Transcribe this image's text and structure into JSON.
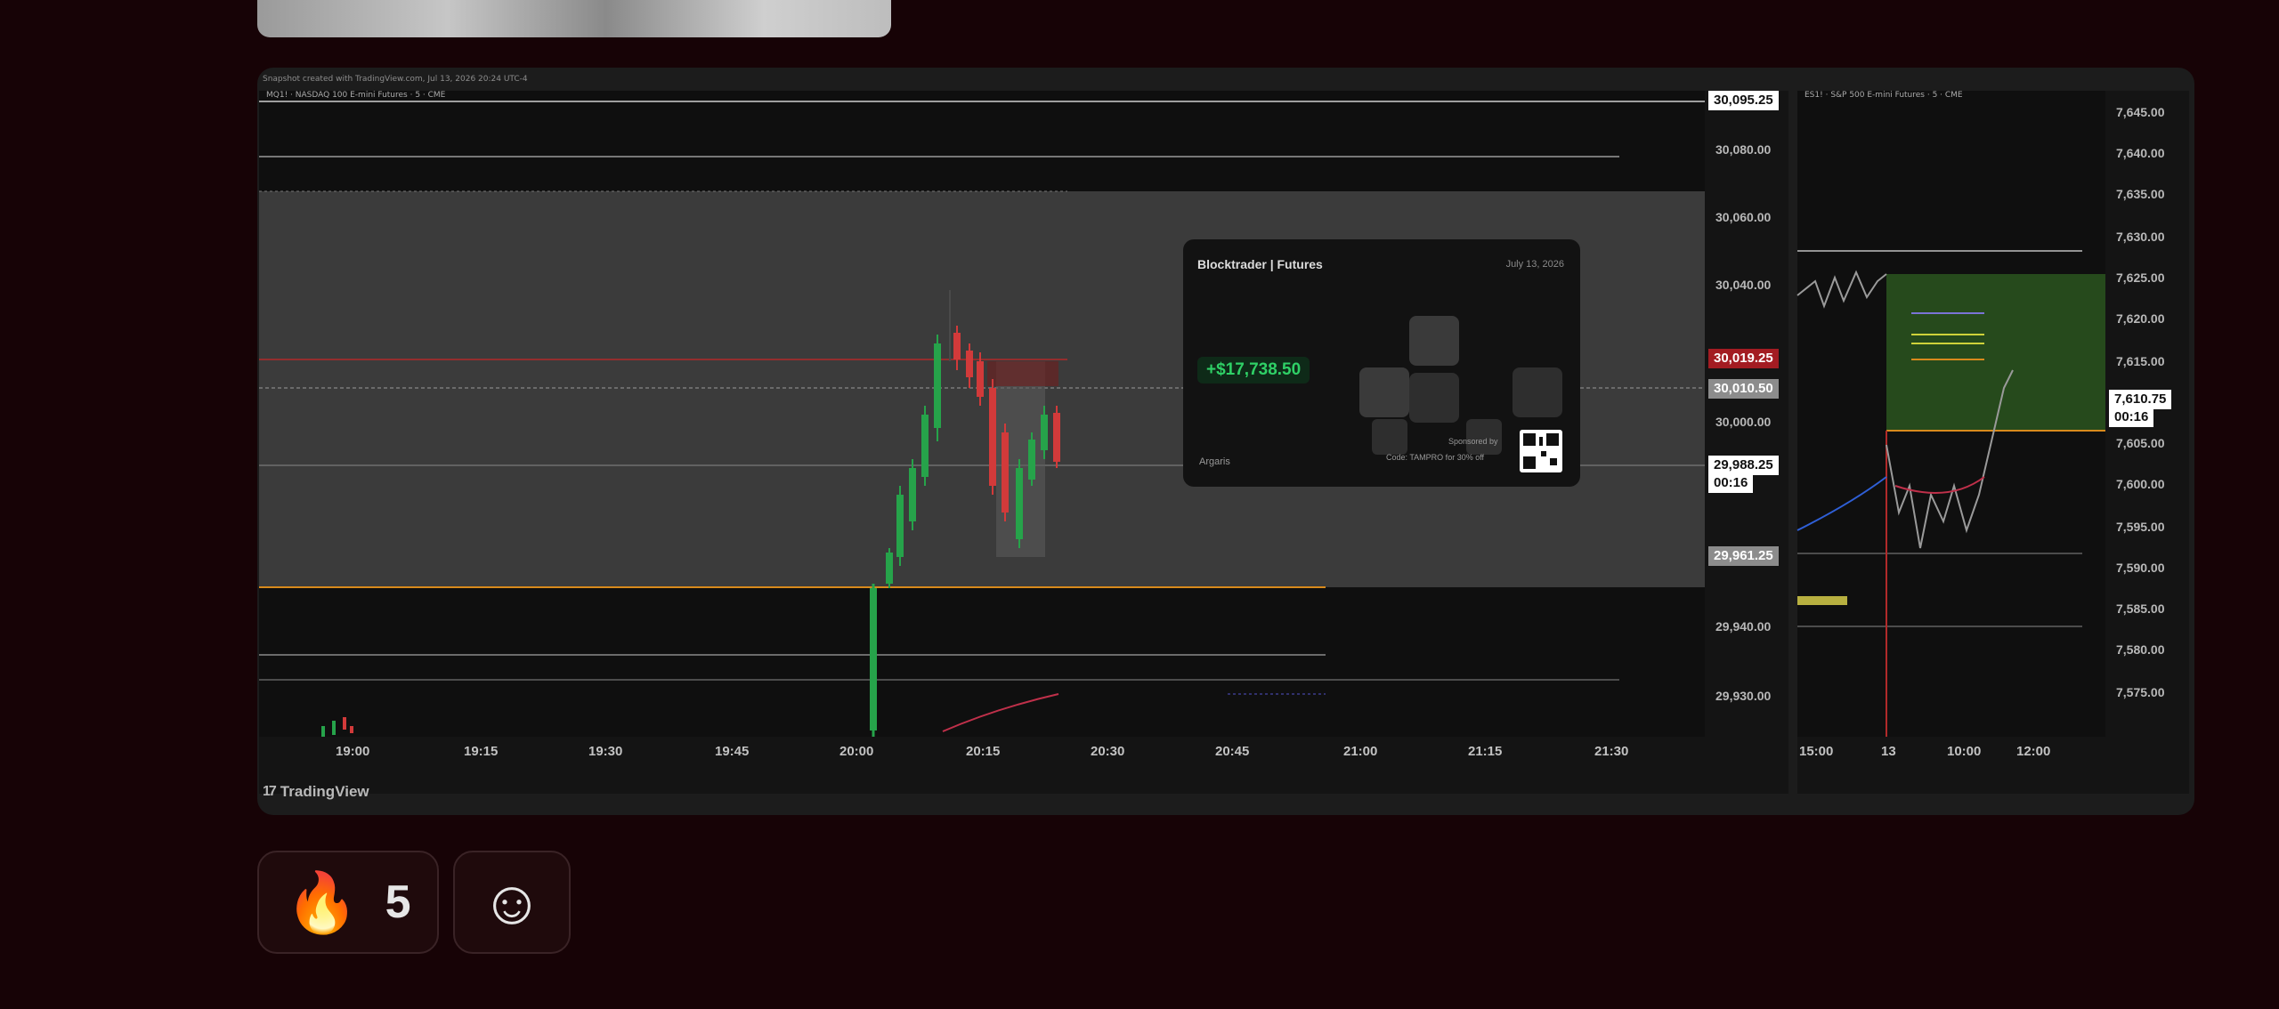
{
  "embed": {
    "header_text": "Snapshot created with TradingView.com, Jul 13, 2026 20:24 UTC-4",
    "brand_label": "TradingView",
    "left_chart": {
      "title": "MQ1! · NASDAQ 100 E-mini Futures · 5 · CME",
      "price_axis": [
        "30,080.00",
        "30,060.00",
        "30,040.00",
        "30,000.00",
        "29,940.00",
        "29,930.00"
      ],
      "time_axis": [
        "19:00",
        "19:15",
        "19:30",
        "19:45",
        "20:00",
        "20:15",
        "20:30",
        "20:45",
        "21:00",
        "21:15",
        "21:30"
      ],
      "tags": [
        {
          "text": "30,095.25",
          "bg": "#ffffff",
          "fg": "#111111"
        },
        {
          "text": "30,019.25",
          "bg": "#a31c22",
          "fg": "#ffffff"
        },
        {
          "text": "30,010.50",
          "bg": "#8c8c8c",
          "fg": "#ffffff"
        },
        {
          "text": "29,988.25",
          "bg": "#ffffff",
          "fg": "#111111"
        },
        {
          "text": "00:16",
          "bg": "#ffffff",
          "fg": "#111111"
        },
        {
          "text": "29,961.25",
          "bg": "#8c8c8c",
          "fg": "#ffffff"
        }
      ]
    },
    "right_chart": {
      "title": "ES1! · S&P 500 E-mini Futures · 5 · CME",
      "price_axis": [
        "7,645.00",
        "7,640.00",
        "7,635.00",
        "7,630.00",
        "7,625.00",
        "7,620.00",
        "7,615.00",
        "7,605.00",
        "7,600.00",
        "7,595.00",
        "7,590.00",
        "7,585.00",
        "7,580.00",
        "7,575.00"
      ],
      "time_axis": [
        "15:00",
        "13",
        "10:00",
        "12:00"
      ],
      "tags": [
        {
          "text": "7,610.75",
          "bg": "#ffffff",
          "fg": "#111111"
        },
        {
          "text": "00:16",
          "bg": "#ffffff",
          "fg": "#111111"
        }
      ]
    },
    "pnl_card": {
      "brand": "Blocktrader | Futures",
      "date": "July 13, 2026",
      "pnl": "+$17,738.50",
      "user": "Argaris",
      "code": "Code: TAMPRO for 30% off",
      "sponsor": "Sponsored by"
    }
  },
  "reactions": [
    {
      "icon": "fire",
      "emoji": "🔥",
      "count": "5"
    },
    {
      "icon": "add-reaction",
      "emoji": "☺"
    }
  ],
  "colors": {
    "page_bg": "#170306",
    "chart_bg": "#101010",
    "highlight_zone": "#3d3d3d",
    "up_candle": "#26a34a",
    "down_candle": "#d23a3a",
    "orange_level": "#d88a1c",
    "green_zone": "#264a1c"
  }
}
